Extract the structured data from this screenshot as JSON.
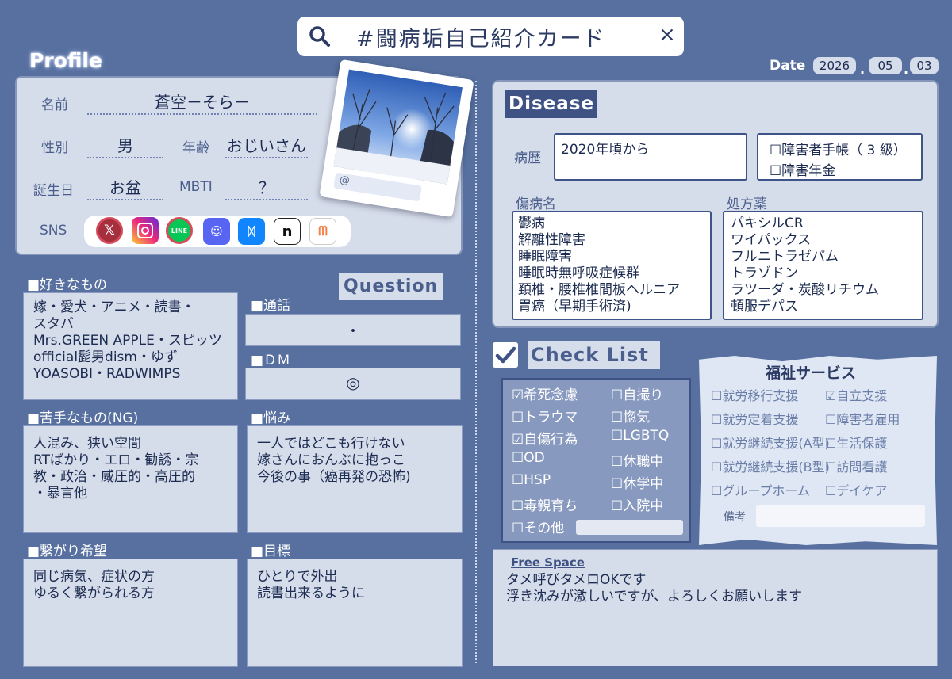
{
  "header": {
    "title": "#闘病垢自己紹介カード",
    "close": "×"
  },
  "profile": {
    "heading": "Profile",
    "name_label": "名前",
    "name": "蒼空－そら－",
    "gender_label": "性別",
    "gender": "男",
    "age_label": "年齢",
    "age": "おじいさん",
    "birthday_label": "誕生日",
    "birthday": "お盆",
    "mbti_label": "MBTI",
    "mbti": "？",
    "sns_label": "SNS",
    "sns_icons": [
      "x-icon",
      "instagram-icon",
      "line-icon",
      "discord-icon",
      "bluesky-icon",
      "note-icon",
      "misskey-icon"
    ],
    "photo_at": "@"
  },
  "date": {
    "label": "Date",
    "year": "2026",
    "month": "05",
    "day": "03",
    "sep": "."
  },
  "likes": {
    "heading": "■好きなもの",
    "text": "嫁・愛犬・アニメ・読書・\nスタバ\nMrs.GREEN APPLE・スピッツ\nofficial髭男dism・ゆず\nYOASOBI・RADWIMPS"
  },
  "question": {
    "heading": "Question",
    "call_heading": "■通話",
    "call": "・",
    "dm_heading": "■ＤＭ",
    "dm": "◎",
    "worry_heading": "■悩み",
    "worry": "一人ではどこも行けない\n嫁さんにおんぶに抱っこ\n今後の事（癌再発の恐怖)",
    "goal_heading": "■目標",
    "goal": "ひとりで外出\n読書出来るように"
  },
  "dislikes": {
    "heading": "■苦手なもの(NG)",
    "text": "人混み、狭い空間\nRTばかり・エロ・勧誘・宗\n教・政治・威圧的・高圧的\n・暴言他"
  },
  "connect": {
    "heading": "■繋がり希望",
    "text": "同じ病気、症状の方\nゆるく繋がられる方"
  },
  "disease": {
    "heading": "Disease",
    "history_label": "病歴",
    "history": "2020年頃から",
    "cert": "☐障害者手帳（ 3 級）",
    "pension": "☐障害年金",
    "diag_label": "傷病名",
    "diagnoses": "鬱病\n解離性障害\n睡眠障害\n睡眠時無呼吸症候群\n頚椎・腰椎椎間板ヘルニア\n胃癌（早期手術済)",
    "meds_label": "処方薬",
    "meds": "パキシルCR\nワイパックス\nフルニトラゼパム\nトラゾドン\nラツーダ・炭酸リチウム\n頓服デパス"
  },
  "checklist": {
    "heading": "Check List",
    "left": [
      "☑希死念慮",
      "☐トラウマ",
      "☑自傷行為",
      "☐OD",
      "☐HSP",
      "☐毒親育ち",
      "☐その他"
    ],
    "right": [
      "☐自撮り",
      "☐惚気",
      "☐LGBTQ",
      "☐休職中",
      "☐休学中",
      "☐入院中"
    ]
  },
  "welfare": {
    "heading": "福祉サービス",
    "left": [
      "☐就労移行支援",
      "☐就労定着支援",
      "☐就労継続支援(A型)",
      "☐就労継続支援(B型)",
      "☐グループホーム"
    ],
    "right": [
      "☑自立支援",
      "☐障害者雇用",
      "☐生活保護",
      "☐訪問看護",
      "☐デイケア"
    ],
    "note_label": "備考"
  },
  "free_space": {
    "heading": "Free Space",
    "text": "タメ呼びタメロOKです\n浮き沈みが激しいですが、よろしくお願いします"
  },
  "colors": {
    "background": "#57709f",
    "card": "#d5dcea",
    "accent": "#1c2b50",
    "text_blue": "#4b5f8c"
  }
}
